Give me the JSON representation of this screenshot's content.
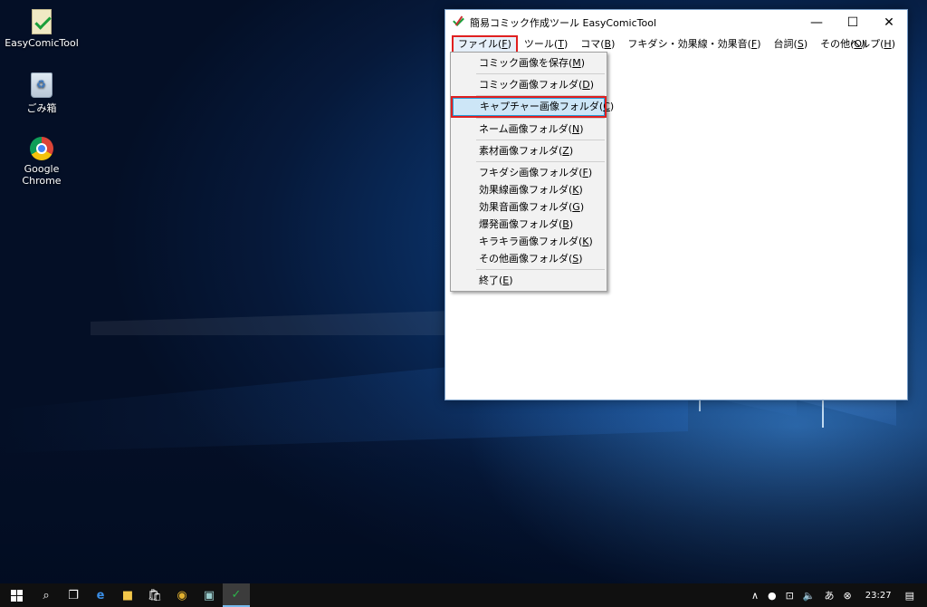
{
  "desktop": {
    "icons": [
      {
        "label": "EasyComicTool"
      },
      {
        "label": "ごみ箱"
      },
      {
        "label": "Google Chrome"
      }
    ]
  },
  "window": {
    "title": "簡易コミック作成ツール EasyComicTool",
    "buttons": {
      "minimize": "—",
      "maximize": "☐",
      "close": "✕"
    }
  },
  "menubar": {
    "file": {
      "text": "ファイル(",
      "key": "F",
      "end": ")"
    },
    "tool": {
      "text": "ツール(",
      "key": "T",
      "end": ")"
    },
    "koma": {
      "text": "コマ(",
      "key": "B",
      "end": ")"
    },
    "fukidashi": {
      "text": "フキダシ・効果線・効果音(",
      "key": "F",
      "end": ")"
    },
    "serif": {
      "text": "台詞(",
      "key": "S",
      "end": ")"
    },
    "other": {
      "text": "その他(",
      "key": "O",
      "end": ")"
    },
    "help": {
      "text": "ヘルプ(",
      "key": "H",
      "end": ")"
    }
  },
  "file_menu": {
    "save": {
      "text": "コミック画像を保存(",
      "key": "M",
      "end": ")"
    },
    "comic_folder": {
      "text": "コミック画像フォルダ(",
      "key": "D",
      "end": ")"
    },
    "capture_folder": {
      "text": "キャプチャー画像フォルダ(",
      "key": "C",
      "end": ")"
    },
    "name_folder": {
      "text": "ネーム画像フォルダ(",
      "key": "N",
      "end": ")"
    },
    "material_folder": {
      "text": "素材画像フォルダ(",
      "key": "Z",
      "end": ")"
    },
    "fukidashi_folder": {
      "text": "フキダシ画像フォルダ(",
      "key": "F",
      "end": ")"
    },
    "effectline_folder": {
      "text": "効果線画像フォルダ(",
      "key": "K",
      "end": ")"
    },
    "sound_folder": {
      "text": "効果音画像フォルダ(",
      "key": "G",
      "end": ")"
    },
    "explosion_folder": {
      "text": "爆発画像フォルダ(",
      "key": "B",
      "end": ")"
    },
    "sparkle_folder": {
      "text": "キラキラ画像フォルダ(",
      "key": "K",
      "end": ")"
    },
    "other_folder": {
      "text": "その他画像フォルダ(",
      "key": "S",
      "end": ")"
    },
    "exit": {
      "text": "終了(",
      "key": "E",
      "end": ")"
    }
  },
  "taskbar": {
    "clock": "23:27"
  }
}
